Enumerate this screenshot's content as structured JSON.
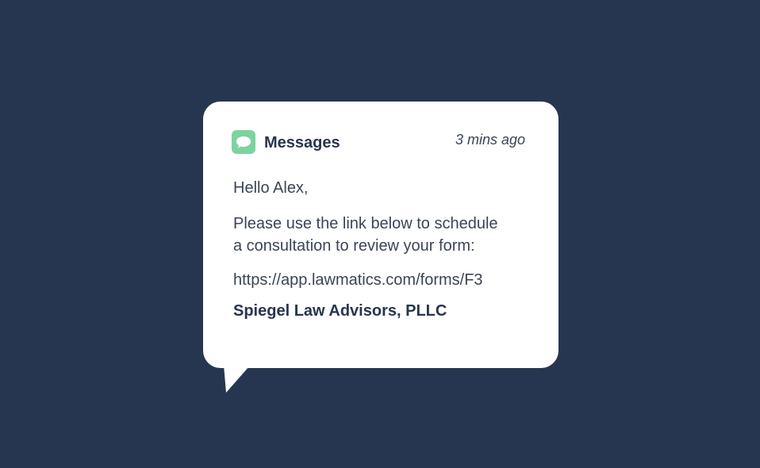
{
  "notification": {
    "app_name": "Messages",
    "time": "3 mins ago",
    "greeting": "Hello Alex,",
    "message_lines": [
      "Please use the link below to schedule",
      "a consultation to review your form:"
    ],
    "link": "https://app.lawmatics.com/forms/F3",
    "signature": "Spiegel Law Advisors, PLLC",
    "app_icon": "chat-bubble-icon"
  },
  "colors": {
    "background": "#273650",
    "bubble": "#ffffff",
    "icon_green": "#7dd3a0",
    "heading_text": "#273650",
    "body_text": "#3b4557"
  }
}
